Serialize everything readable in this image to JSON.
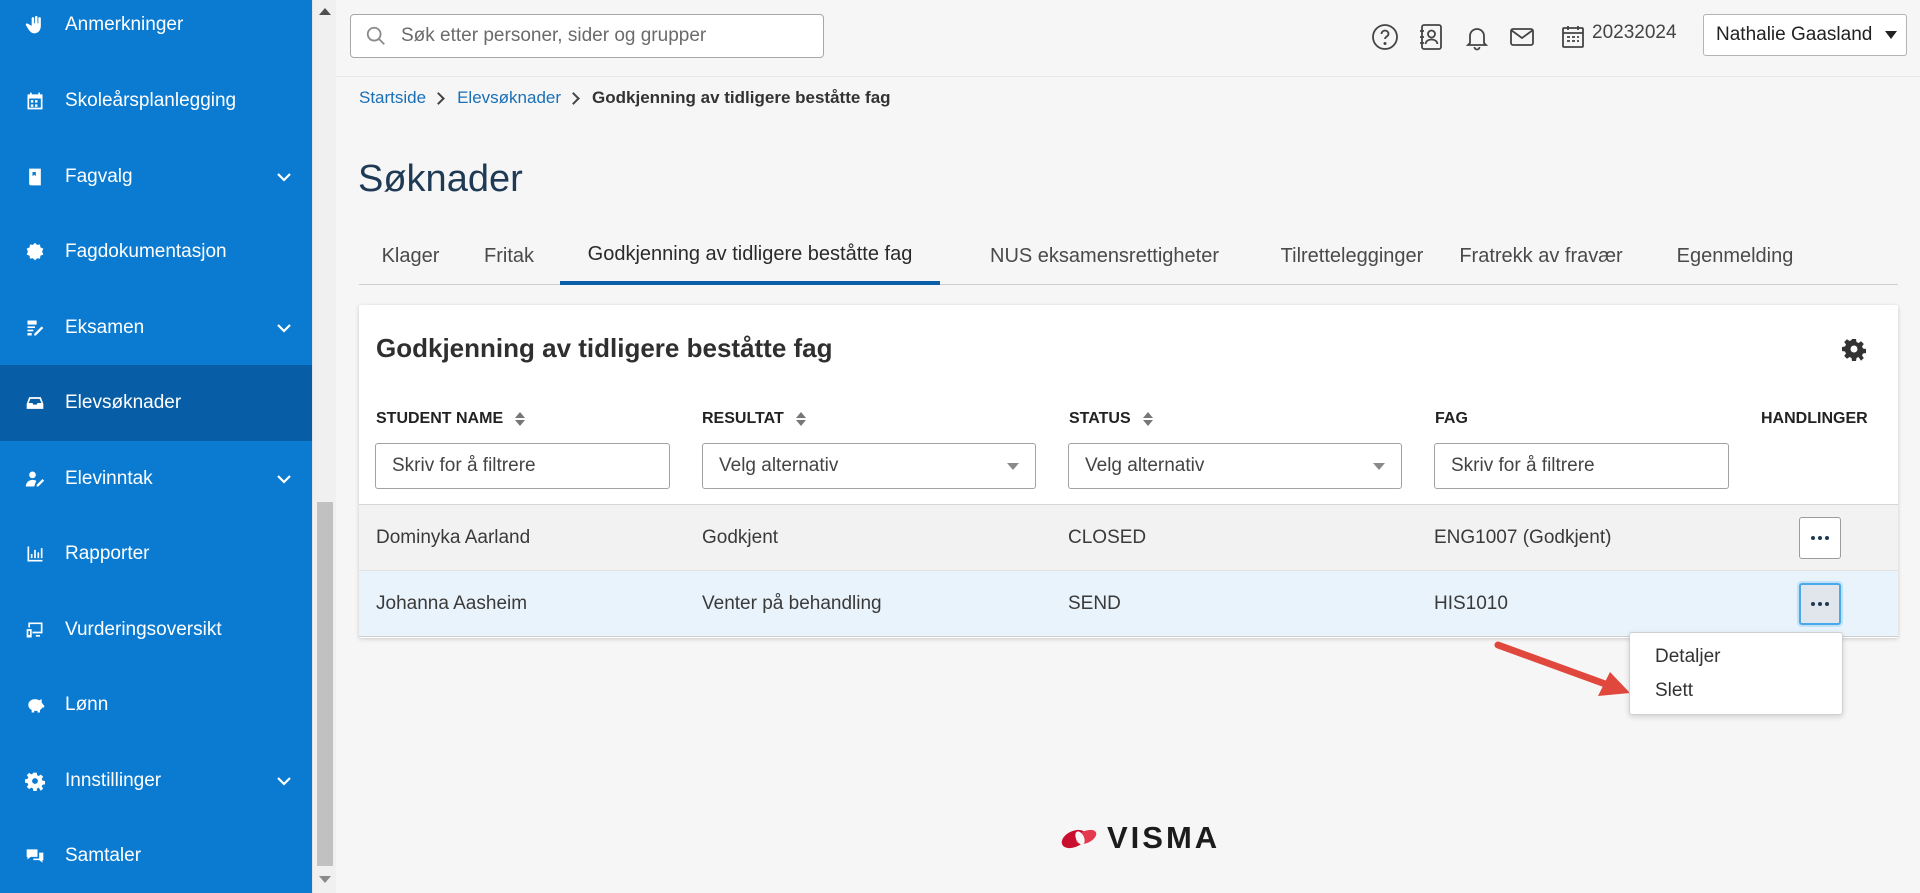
{
  "sidebar": {
    "items": [
      {
        "label": "Anmerkninger",
        "icon": "hand-icon"
      },
      {
        "label": "Skoleårsplanlegging",
        "icon": "calendar-icon"
      },
      {
        "label": "Fagvalg",
        "icon": "book-icon"
      },
      {
        "label": "Fagdokumentasjon",
        "icon": "badge-icon"
      },
      {
        "label": "Eksamen",
        "icon": "edit-paper-icon"
      },
      {
        "label": "Elevsøknader",
        "icon": "inbox-icon"
      },
      {
        "label": "Elevinntak",
        "icon": "user-edit-icon"
      },
      {
        "label": "Rapporter",
        "icon": "bar-chart-icon"
      },
      {
        "label": "Vurderingsoversikt",
        "icon": "monitor-icon"
      },
      {
        "label": "Lønn",
        "icon": "piggy-bank-icon"
      },
      {
        "label": "Innstillinger",
        "icon": "gear-icon"
      },
      {
        "label": "Samtaler",
        "icon": "chat-icon"
      }
    ]
  },
  "topbar": {
    "search_placeholder": "Søk etter personer, sider og grupper",
    "school_year": "20232024",
    "user_name": "Nathalie Gaasland"
  },
  "breadcrumb": {
    "home": "Startside",
    "section": "Elevsøknader",
    "current": "Godkjenning av tidligere beståtte fag"
  },
  "page": {
    "title": "Søknader"
  },
  "tabs": [
    {
      "label": "Klager"
    },
    {
      "label": "Fritak"
    },
    {
      "label": "Godkjenning av tidligere beståtte fag"
    },
    {
      "label": "NUS eksamensrettigheter"
    },
    {
      "label": "Tilrettelegginger"
    },
    {
      "label": "Fratrekk av fravær"
    },
    {
      "label": "Egenmelding"
    }
  ],
  "card": {
    "title": "Godkjenning av tidligere beståtte fag",
    "columns": {
      "student": "STUDENT NAME",
      "result": "RESULTAT",
      "status": "STATUS",
      "subject": "FAG",
      "actions": "HANDLINGER"
    },
    "filters": {
      "student": "Skriv for å filtrere",
      "result": "Velg alternativ",
      "status": "Velg alternativ",
      "subject": "Skriv for å filtrere"
    },
    "rows": [
      {
        "student": "Dominyka Aarland",
        "result": "Godkjent",
        "status": "CLOSED",
        "subject": "ENG1007 (Godkjent)"
      },
      {
        "student": "Johanna Aasheim",
        "result": "Venter på behandling",
        "status": "SEND",
        "subject": "HIS1010"
      }
    ]
  },
  "menu": {
    "items": [
      "Detaljer",
      "Slett"
    ]
  },
  "footer": {
    "logo_text": "VISMA"
  },
  "colors": {
    "sidebar": "#0b7bd1",
    "sidebar_active": "#075ea6",
    "tab_active": "#0b5fa8",
    "link": "#1a6fb5",
    "arrow": "#e0483d",
    "logo_red": "#c8102e"
  }
}
